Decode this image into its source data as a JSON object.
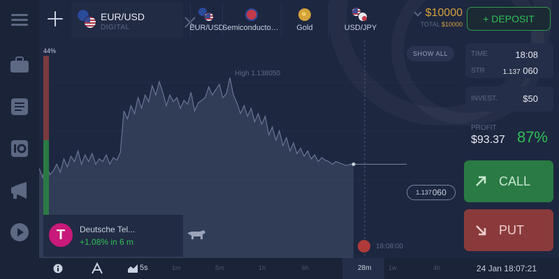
{
  "topbar": {
    "active_tab": {
      "title": "EUR/USD",
      "subtitle": "DIGITAL"
    },
    "assets": [
      {
        "label": "EUR/USD",
        "icon": "eur-usd-flag-icon"
      },
      {
        "label": "Semiconductor ...",
        "icon": "semiconductor-icon"
      },
      {
        "label": "Gold",
        "icon": "gold-icon"
      },
      {
        "label": "USD/JPY",
        "icon": "usd-jpy-flag-icon"
      }
    ],
    "balance": {
      "amount": "$10000",
      "total_label": "TOTAL",
      "total_value": "$10000"
    },
    "deposit_label": "+ DEPOSIT"
  },
  "chart": {
    "percent_label": "44%",
    "high_label": "High 1.138050",
    "show_all": "SHOW ALL",
    "current_price_prefix": "1.137",
    "current_price_suffix": "060",
    "expiry_time": "18:08:00"
  },
  "asset_card": {
    "name": "Deutsche Tel...",
    "change": "+1.08% in 6 m",
    "logo_letter": "T"
  },
  "panel": {
    "time_label": "TIME",
    "time_value": "18:08",
    "strike_label": "STR",
    "strike_prefix": "1.137",
    "strike_suffix": "060",
    "invest_label": "INVEST.",
    "invest_value": "$50",
    "profit_label": "PROFIT",
    "profit_amount": "$93.37",
    "profit_percent": "87%",
    "call_label": "CALL",
    "put_label": "PUT"
  },
  "bottombar": {
    "candle_timeframe": "5s",
    "timeframes": [
      "1m",
      "5m",
      "1h",
      "6h",
      "28m",
      "1w",
      "4h"
    ],
    "active_timeframe": "28m",
    "datetime": "24 Jan 18:07:21"
  },
  "colors": {
    "call": "#2a7a44",
    "put": "#8a3a3a",
    "accent_green": "#2fbf55",
    "gold": "#d4a23a"
  },
  "chart_data": {
    "type": "area",
    "x": [
      0,
      1,
      2,
      3,
      4,
      5,
      6,
      7,
      8,
      9,
      10,
      11,
      12,
      13,
      14,
      15,
      16,
      17,
      18,
      19,
      20,
      21,
      22,
      23,
      24,
      25,
      26,
      27,
      28,
      29,
      30,
      31,
      32,
      33,
      34,
      35,
      36,
      37,
      38,
      39,
      40,
      41,
      42,
      43,
      44,
      45,
      46,
      47,
      48,
      49,
      50,
      51,
      52,
      53,
      54,
      55,
      56,
      57,
      58,
      59,
      60,
      61,
      62,
      63,
      64,
      65,
      66,
      67,
      68,
      69,
      70,
      71,
      72,
      73,
      74,
      75,
      76,
      77,
      78,
      79,
      80,
      81,
      82,
      83,
      84,
      85,
      86,
      87,
      88,
      89
    ],
    "values": [
      0.35,
      0.28,
      0.4,
      0.3,
      0.33,
      0.38,
      0.32,
      0.42,
      0.36,
      0.44,
      0.4,
      0.48,
      0.38,
      0.45,
      0.4,
      0.46,
      0.38,
      0.42,
      0.4,
      0.45,
      0.38,
      0.43,
      0.41,
      0.47,
      0.78,
      0.72,
      0.82,
      0.76,
      0.88,
      0.8,
      0.9,
      0.85,
      0.97,
      0.9,
      1.0,
      0.92,
      0.82,
      0.9,
      0.85,
      0.88,
      0.8,
      0.86,
      0.83,
      0.92,
      0.78,
      0.84,
      0.86,
      0.88,
      0.96,
      0.9,
      0.94,
      0.98,
      0.88,
      0.91,
      1.03,
      0.9,
      0.84,
      0.76,
      0.82,
      0.74,
      0.8,
      0.7,
      0.76,
      0.68,
      0.74,
      0.6,
      0.66,
      0.56,
      0.63,
      0.52,
      0.58,
      0.48,
      0.54,
      0.46,
      0.5,
      0.44,
      0.48,
      0.42,
      0.45,
      0.4,
      0.43,
      0.41,
      0.4,
      0.38,
      0.4,
      0.39,
      0.38,
      0.37,
      0.38,
      0.38
    ],
    "title": "",
    "xlabel": "",
    "ylabel": "",
    "ylim": [
      0,
      1.1
    ]
  }
}
